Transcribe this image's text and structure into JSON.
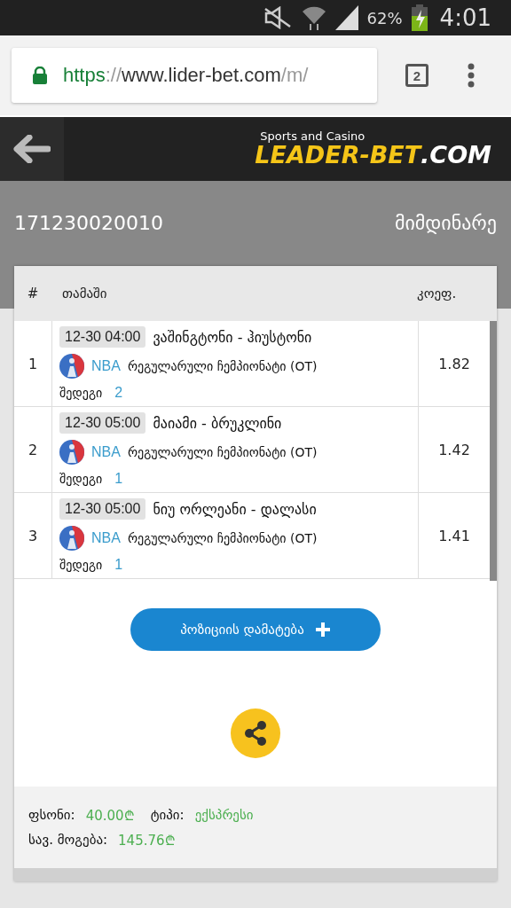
{
  "status_bar": {
    "battery": "62%",
    "time": "4:01"
  },
  "browser": {
    "url_scheme": "https",
    "url_separator": "://",
    "url_host": "www.lider-bet.com",
    "url_path": "/m/",
    "tab_count": "2"
  },
  "header": {
    "logo_tagline": "Sports and Casino",
    "logo_main": "LEADER-BET",
    "logo_suffix": ".COM"
  },
  "ticket": {
    "id": "171230020010",
    "status": "მიმდინარე"
  },
  "table": {
    "columns": [
      "#",
      "თამაში",
      "კოეფ."
    ],
    "rows": [
      {
        "number": "1",
        "time": "12-30 04:00",
        "match": "ვაშინგტონი - ჰიუსტონი",
        "league": "NBA",
        "tournament": "რეგულარული ჩემპიონატი (OT)",
        "outcome_label": "შედეგი",
        "outcome": "2",
        "odds": "1.82"
      },
      {
        "number": "2",
        "time": "12-30 05:00",
        "match": "მაიამი - ბრუკლინი",
        "league": "NBA",
        "tournament": "რეგულარული ჩემპიონატი (OT)",
        "outcome_label": "შედეგი",
        "outcome": "1",
        "odds": "1.42"
      },
      {
        "number": "3",
        "time": "12-30 05:00",
        "match": "ნიუ ორლეანი - დალასი",
        "league": "NBA",
        "tournament": "რეგულარული ჩემპიონატი (OT)",
        "outcome_label": "შედეგი",
        "outcome": "1",
        "odds": "1.41"
      }
    ]
  },
  "add_button": "პოზიციის დამატება",
  "summary": {
    "stake_label": "ფსონი:",
    "stake": "40.00₾",
    "type_label": "ტიპი:",
    "type": "ექსპრესი",
    "win_label": "სავ. მოგება:",
    "win": "145.76₾"
  }
}
